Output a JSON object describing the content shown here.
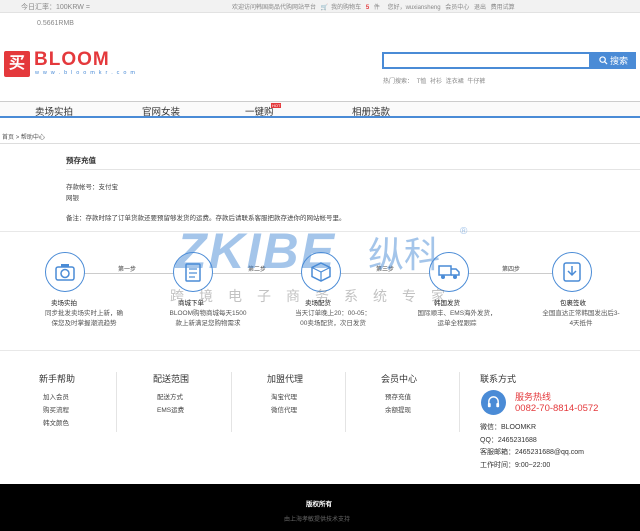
{
  "topbar": {
    "rate_label": "今日汇率：100KRW =",
    "welcome": "欢迎访问韩国商品代购网站平台",
    "cart_label": "我的购物车",
    "cart_count": "5",
    "cart_unit": "件",
    "greeting": "您好，wuxiansheng",
    "member_center": "会员中心",
    "logout": "退出",
    "apply_trial": "费用试算"
  },
  "rate_value": "0.5661RMB",
  "logo": {
    "mark": "买",
    "name": "BLOOM",
    "url": "w w w . b l o o m k r . c o m"
  },
  "search": {
    "placeholder": "",
    "button": "搜索"
  },
  "hot_search": {
    "label": "热门搜索：",
    "terms": [
      "T恤",
      "衬衫",
      "连衣裙",
      "牛仔裤"
    ]
  },
  "nav": {
    "items": [
      "卖场实拍",
      "官网女装",
      "一键购",
      "相册选款"
    ],
    "hot_badge": "HOT"
  },
  "breadcrumb": {
    "home": "首页",
    "sep": ">",
    "current": "帮助中心"
  },
  "content": {
    "title": "预存充值",
    "line1": "存款帐号：支付宝",
    "line2": "网银",
    "note": "备注：存款时除了订单货款还要预留够发货的运费。存款后请联系客服把款存进你的网站帐号里。"
  },
  "steps": {
    "labels": [
      "第一步",
      "第二步",
      "第三步",
      "第四步"
    ],
    "items": [
      {
        "title": "卖场实拍",
        "desc": [
          "同步批发卖场实时上新，确",
          "保您及时掌握潮流趋势"
        ]
      },
      {
        "title": "商城下单",
        "desc": [
          "BLOOM购物商城每天1500",
          "款上新满足您购物需求"
        ]
      },
      {
        "title": "卖场配货",
        "desc": [
          "当天订单晚上20：00-05：",
          "00卖场配货，次日发货"
        ]
      },
      {
        "title": "韩国发货",
        "desc": [
          "国际顺丰、EMS海外发货，",
          "运单全程跟踪"
        ]
      },
      {
        "title": "包裹签收",
        "desc": [
          "全国直达正常韩国发出后3-",
          "4天抵件"
        ]
      }
    ]
  },
  "watermark": {
    "brand": "ZKIBE",
    "cn": "纵科",
    "sub": "跨境电子商务系统专家",
    "reg": "®"
  },
  "footer_cols": [
    {
      "heading": "新手帮助",
      "links": [
        "加入会员",
        "购买流程",
        "韩文颜色"
      ]
    },
    {
      "heading": "配送范围",
      "links": [
        "配送方式",
        "EMS运费"
      ]
    },
    {
      "heading": "加盟代理",
      "links": [
        "淘宝代理",
        "微信代理"
      ]
    },
    {
      "heading": "会员中心",
      "links": [
        "预存充值",
        "余额提现"
      ]
    }
  ],
  "contact": {
    "heading": "联系方式",
    "hotline_label": "服务热线",
    "hotline": "0082-70-8814-0572",
    "wechat": "微信：BLOOMKR",
    "qq": "QQ：2465231688",
    "email": "客服邮箱：2465231688@qq.com",
    "hours": "工作时间：9:00~22:00"
  },
  "footer": {
    "copyright": "版权所有",
    "tech": "由上海孝敏提供技术支持"
  },
  "colors": {
    "accent": "#4a8bd6",
    "brand": "#e4393c",
    "footer_bg": "#000000"
  }
}
